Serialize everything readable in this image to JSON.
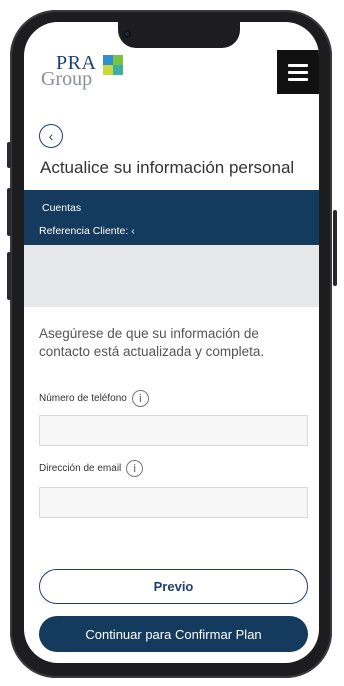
{
  "logo": {
    "brand_top": "PRA",
    "brand_bottom": "Group"
  },
  "header": {
    "menu_icon": "hamburger-icon"
  },
  "page": {
    "back_icon": "chevron-left-icon",
    "back_glyph": "‹",
    "title": "Actualice su información personal"
  },
  "account_band": {
    "accounts_label": "Cuentas",
    "reference_label": "Referencia Cliente: ‹"
  },
  "form": {
    "intro": "Asegúrese de que su información de contacto está actualizada y completa.",
    "phone_label": "Número de teléfono",
    "phone_value": "",
    "email_label": "Dirección de email",
    "email_value": "",
    "info_glyph": "i"
  },
  "actions": {
    "previous_label": "Previo",
    "continue_label": "Continuar para Confirmar Plan"
  },
  "colors": {
    "primary": "#143a5e",
    "accent_green": "#7dc242",
    "accent_blue": "#2f8fd0",
    "accent_lime": "#c8d93a"
  }
}
